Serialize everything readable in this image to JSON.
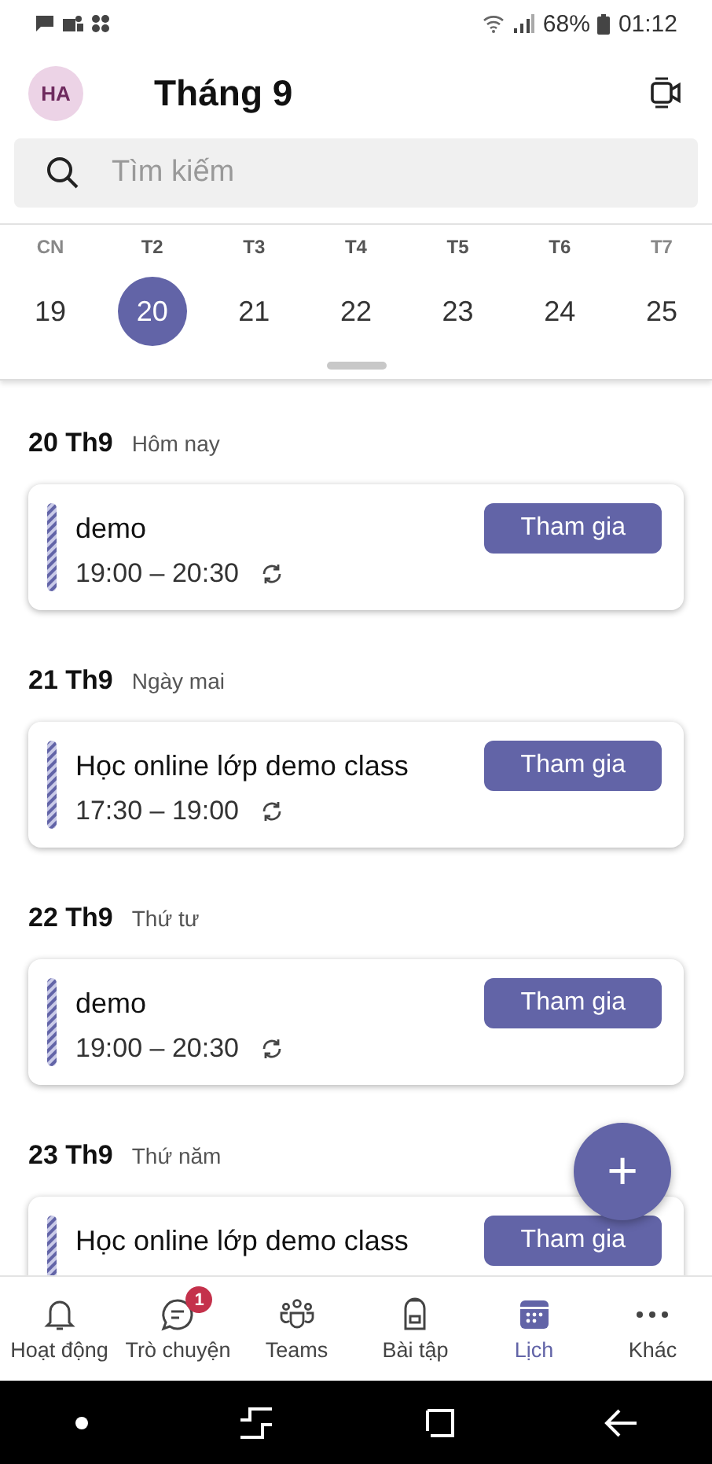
{
  "status_bar": {
    "battery": "68%",
    "time": "01:12"
  },
  "header": {
    "avatar": "HA",
    "title": "Tháng 9"
  },
  "search": {
    "placeholder": "Tìm kiếm"
  },
  "week": [
    {
      "day": "CN",
      "date": "19",
      "selected": false
    },
    {
      "day": "T2",
      "date": "20",
      "selected": true
    },
    {
      "day": "T3",
      "date": "21",
      "selected": false
    },
    {
      "day": "T4",
      "date": "22",
      "selected": false
    },
    {
      "day": "T5",
      "date": "23",
      "selected": false
    },
    {
      "day": "T6",
      "date": "24",
      "selected": false
    },
    {
      "day": "T7",
      "date": "25",
      "selected": false
    }
  ],
  "agenda": [
    {
      "date": "20 Th9",
      "note": "Hôm nay",
      "events": [
        {
          "title": "demo",
          "time": "19:00 – 20:30",
          "recurring": true,
          "action": "Tham gia"
        }
      ]
    },
    {
      "date": "21 Th9",
      "note": "Ngày mai",
      "events": [
        {
          "title": "Học online lớp demo class",
          "time": "17:30 – 19:00",
          "recurring": true,
          "action": "Tham gia"
        }
      ]
    },
    {
      "date": "22 Th9",
      "note": "Thứ tư",
      "events": [
        {
          "title": "demo",
          "time": "19:00 – 20:30",
          "recurring": true,
          "action": "Tham gia"
        }
      ]
    },
    {
      "date": "23 Th9",
      "note": "Thứ năm",
      "events": [
        {
          "title": "Học online lớp demo class",
          "action": "Tham gia"
        }
      ]
    }
  ],
  "fab": "+",
  "tabs": [
    {
      "kind": "bell",
      "label": "Hoạt động",
      "selected": false
    },
    {
      "kind": "chat",
      "label": "Trò chuyện",
      "selected": false,
      "badge": "1"
    },
    {
      "kind": "teams",
      "label": "Teams",
      "selected": false
    },
    {
      "kind": "backpack",
      "label": "Bài tập",
      "selected": false
    },
    {
      "kind": "calendar",
      "label": "Lịch",
      "selected": true
    },
    {
      "kind": "more",
      "label": "Khác",
      "selected": false
    }
  ]
}
